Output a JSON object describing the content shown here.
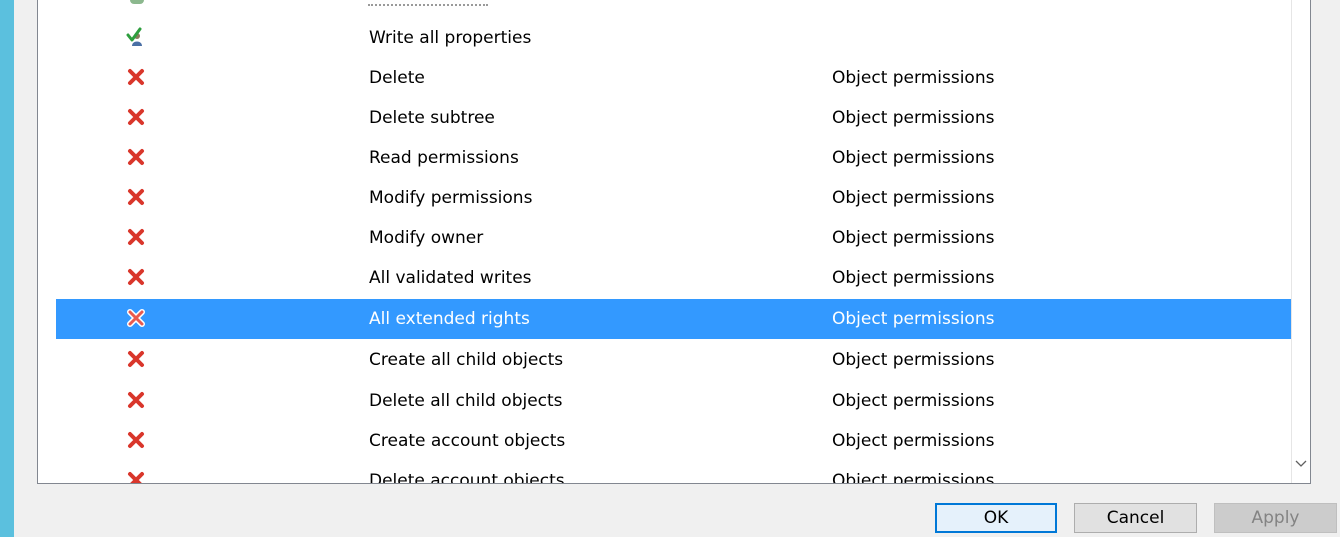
{
  "permissions_list": {
    "rows": [
      {
        "icon": "user-green-check-icon",
        "permission": "Write all properties",
        "applies_to": "",
        "selected": false
      },
      {
        "icon": "red-x-icon",
        "permission": "Delete",
        "applies_to": "Object permissions",
        "selected": false
      },
      {
        "icon": "red-x-icon",
        "permission": "Delete subtree",
        "applies_to": "Object permissions",
        "selected": false
      },
      {
        "icon": "red-x-icon",
        "permission": "Read permissions",
        "applies_to": "Object permissions",
        "selected": false
      },
      {
        "icon": "red-x-icon",
        "permission": "Modify permissions",
        "applies_to": "Object permissions",
        "selected": false
      },
      {
        "icon": "red-x-icon",
        "permission": "Modify owner",
        "applies_to": "Object permissions",
        "selected": false
      },
      {
        "icon": "red-x-icon",
        "permission": "All validated writes",
        "applies_to": "Object permissions",
        "selected": false
      },
      {
        "icon": "red-x-icon",
        "permission": "All extended rights",
        "applies_to": "Object permissions",
        "selected": true
      },
      {
        "icon": "red-x-icon",
        "permission": "Create all child objects",
        "applies_to": "Object permissions",
        "selected": false
      },
      {
        "icon": "red-x-icon",
        "permission": "Delete all child objects",
        "applies_to": "Object permissions",
        "selected": false
      },
      {
        "icon": "red-x-icon",
        "permission": "Create account objects",
        "applies_to": "Object permissions",
        "selected": false
      },
      {
        "icon": "red-x-icon",
        "permission": "Delete account objects",
        "applies_to": "Object permissions",
        "selected": false
      }
    ]
  },
  "buttons": {
    "ok": "OK",
    "cancel": "Cancel",
    "apply": "Apply"
  },
  "colors": {
    "selection": "#3399ff",
    "deny_icon": "#d9362b",
    "accent_strip": "#5bc0de"
  }
}
